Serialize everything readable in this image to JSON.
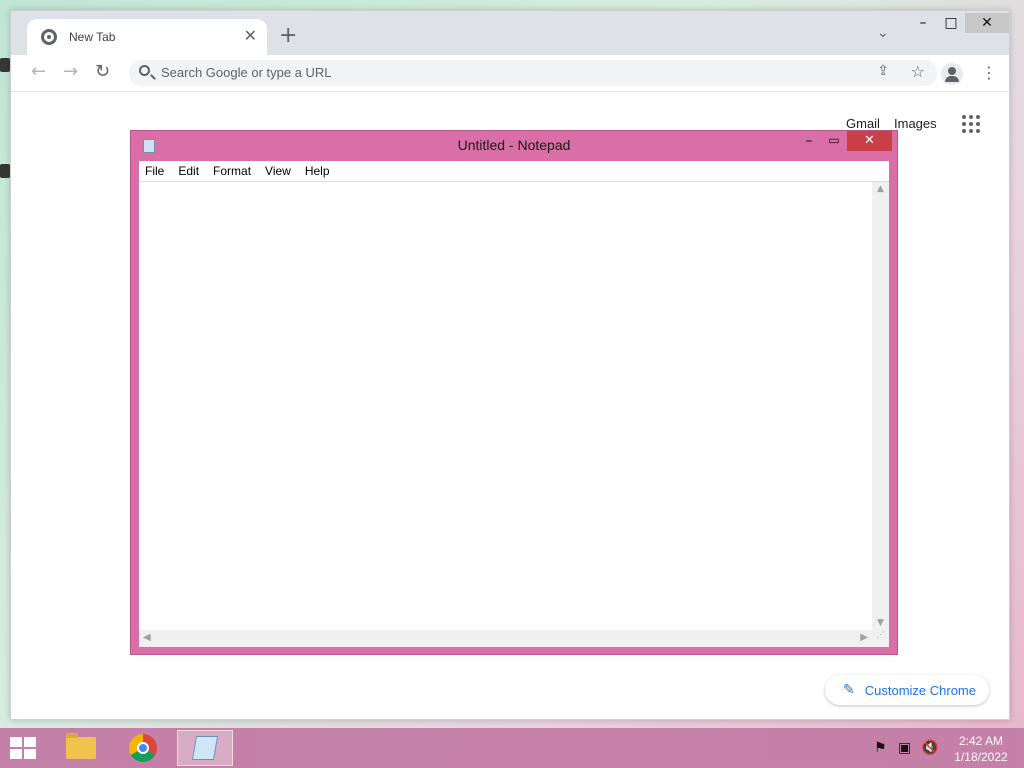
{
  "chrome": {
    "tab_title": "New Tab",
    "tab_close_glyph": "✕",
    "new_tab_glyph": "+",
    "tab_search_glyph": "⌄",
    "window_controls": {
      "minimize": "–",
      "maximize": "□",
      "close": "✕"
    },
    "nav": {
      "back": "←",
      "forward": "→",
      "reload": "↻"
    },
    "omnibox_placeholder": "Search Google or type a URL",
    "omnibox_share_glyph": "⇪",
    "omnibox_star_glyph": "☆",
    "menu_glyph": "⋮",
    "page": {
      "gmail_label": "Gmail",
      "images_label": "Images",
      "customize_label": "Customize Chrome",
      "customize_icon_glyph": "✎"
    }
  },
  "notepad": {
    "title": "Untitled - Notepad",
    "menu": [
      "File",
      "Edit",
      "Format",
      "View",
      "Help"
    ],
    "controls": {
      "minimize": "–",
      "maximize": "▭",
      "close": "✕"
    },
    "scroll": {
      "up": "▲",
      "down": "▼",
      "left": "◀",
      "right": "▶",
      "grip": "⋰"
    },
    "content": ""
  },
  "taskbar": {
    "clock": {
      "time": "2:42 AM",
      "date": "1/18/2022"
    },
    "tray_glyphs": {
      "flag": "⚑",
      "network": "▣",
      "volume": "🔇"
    },
    "apps": [
      "file-explorer",
      "google-chrome",
      "notepad"
    ]
  }
}
